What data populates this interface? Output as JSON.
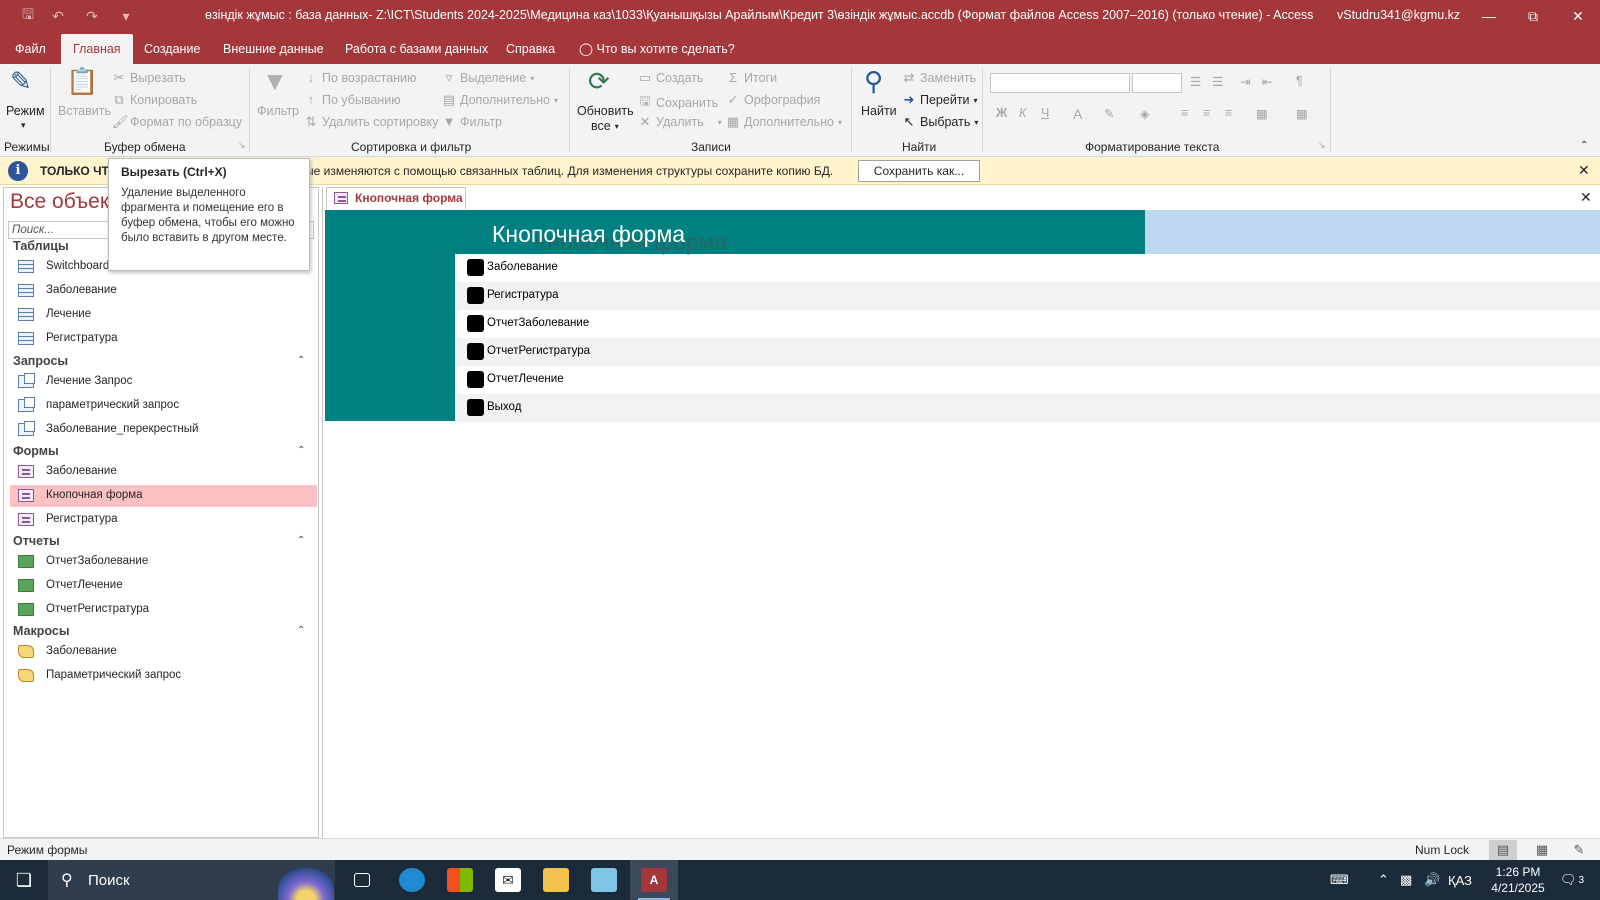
{
  "window": {
    "title": "өзіндік жұмыс : база данных- Z:\\ICT\\Students 2024-2025\\Медицина каз\\1033\\Қуанышқызы Арайлым\\Кредит 3\\өзіндік жұмыс.accdb (Формат файлов Access 2007–2016) (только чтение)  -  Access",
    "user": "vStudru341@kgmu.kz",
    "accent_color": "#a4373a",
    "qat_icons": [
      "save-icon",
      "undo-icon",
      "redo-icon",
      "customize-qat-icon"
    ],
    "controls": [
      "minimize-icon",
      "restore-icon",
      "close-icon"
    ]
  },
  "ribbon_tabs": [
    "Файл",
    "Главная",
    "Создание",
    "Внешние данные",
    "Работа с базами данных",
    "Справка"
  ],
  "active_tab": "Главная",
  "tell_me": "Что вы хотите сделать?",
  "ribbon": {
    "views": {
      "button": "Режим",
      "group": "Режимы"
    },
    "clipboard": {
      "paste": "Вставить",
      "cut": "Вырезать",
      "copy": "Копировать",
      "format_painter": "Формат по образцу",
      "group": "Буфер обмена"
    },
    "sort_filter": {
      "filter": "Фильтр",
      "ascending": "По возрастанию",
      "descending": "По убыванию",
      "remove_sort": "Удалить сортировку",
      "selection": "Выделение",
      "advanced": "Дополнительно",
      "toggle_filter": "Фильтр",
      "group": "Сортировка и фильтр"
    },
    "records": {
      "refresh_1": "Обновить",
      "refresh_2": "все",
      "new": "Создать",
      "save": "Сохранить",
      "delete": "Удалить",
      "totals": "Итоги",
      "spelling": "Орфография",
      "more": "Дополнительно",
      "group": "Записи"
    },
    "find": {
      "find": "Найти",
      "replace": "Заменить",
      "goto": "Перейти",
      "select": "Выбрать",
      "group": "Найти"
    },
    "text_format": {
      "bold": "Ж",
      "italic": "К",
      "underline": "Ч",
      "font_color": "A",
      "group": "Форматирование текста"
    }
  },
  "message_bar": {
    "heading": "ТОЛЬКО ЧТЕНИЕ",
    "text": "ые изменяются с помощью связанных таблиц. Для изменения структуры сохраните копию БД.",
    "button": "Сохранить как..."
  },
  "tooltip": {
    "title": "Вырезать (Ctrl+X)",
    "body": "Удаление выделенного фрагмента и помещение его в буфер обмена, чтобы его можно было вставить в другом месте."
  },
  "nav": {
    "title": "Все объекты",
    "search_placeholder": "Поиск...",
    "sections": [
      {
        "label": "Таблицы",
        "items": [
          "Switchboard Items",
          "Заболевание",
          "Лечение",
          "Регистратура"
        ]
      },
      {
        "label": "Запросы",
        "items": [
          "Лечение Запрос",
          "параметрический запрос",
          "Заболевание_перекрестный"
        ]
      },
      {
        "label": "Формы",
        "items": [
          "Заболевание",
          "Кнопочная форма",
          "Регистратура"
        ]
      },
      {
        "label": "Отчеты",
        "items": [
          "ОтчетЗаболевание",
          "ОтчетЛечение",
          "ОтчетРегистратура"
        ]
      },
      {
        "label": "Макросы",
        "items": [
          "Заболевание",
          "Параметрический запрос"
        ]
      }
    ],
    "selected_item": "Кнопочная форма"
  },
  "document": {
    "tab": "Кнопочная форма",
    "form_title": "Кнопочная форма",
    "form_title_shadow": "Кнопочная форма",
    "header_color": "#008080",
    "buttons": [
      "Заболевание",
      "Регистратура",
      "ОтчетЗаболевание",
      "ОтчетРегистратура",
      "ОтчетЛечение",
      "Выход"
    ]
  },
  "status": {
    "left": "Режим формы",
    "num_lock": "Num Lock"
  },
  "taskbar": {
    "search": "Поиск",
    "lang": "ҚАЗ",
    "time": "1:26 PM",
    "date": "4/21/2025",
    "notifications": "3"
  }
}
